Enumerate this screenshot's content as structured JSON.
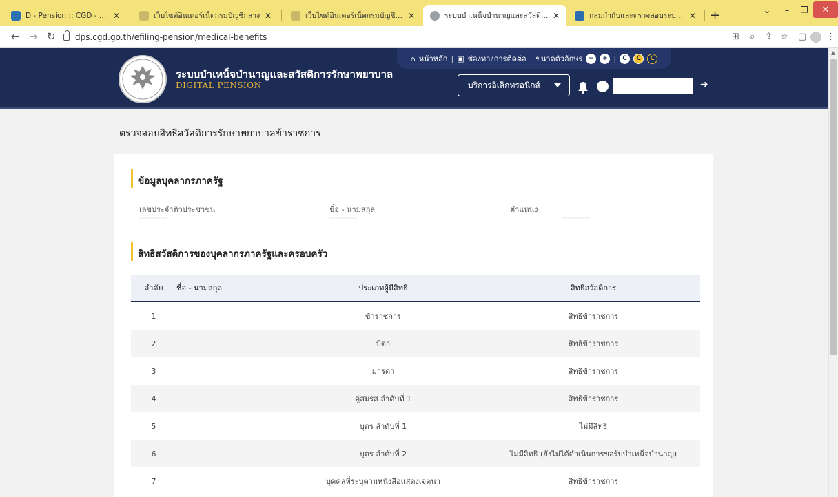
{
  "browser": {
    "tabs": [
      {
        "title": "D - Pension :: CGD - D - Pension",
        "color": "#2f6fb3",
        "active": false
      },
      {
        "title": "เว็บไซต์อินเตอร์เน็ตกรมบัญชีกลาง",
        "color": "#c9b86a",
        "active": false
      },
      {
        "title": "เว็บไซต์อินเตอร์เน็ตกรมบัญชีกลาง",
        "color": "#c9b86a",
        "active": false
      },
      {
        "title": "ระบบบำเหน็จบำนาญและสวัสดิการรักษ",
        "color": "#9aa0a6",
        "active": true
      },
      {
        "title": "กลุ่มกำกับและตรวจสอบระบบสวัสดิการ",
        "color": "#2b6cb0",
        "active": false
      }
    ],
    "new_tab": "+",
    "url": "dps.cgd.go.th/efiling-pension/medical-benefits",
    "window_controls": {
      "dropdown": "⌄",
      "minimize": "–",
      "maximize": "❐",
      "close": "✕"
    }
  },
  "header": {
    "title": "ระบบบำเหน็จบำนาญและสวัสดิการรักษาพยาบาล",
    "subtitle": "DIGITAL PENSION",
    "top_links": {
      "home": "หน้าหลัก",
      "contact": "ช่องทางการติดต่อ",
      "font_size": "ขนาดตัวอักษร",
      "font_minus": "−",
      "font_plus": "+",
      "contrast_c": "C"
    },
    "eservice_label": "บริการอิเล็กทรอนิกส์"
  },
  "page_title": "ตรวจสอบสิทธิสวัสดิการรักษาพยาบาลข้าราชการ",
  "personnel_section": {
    "title": "ข้อมูลบุคลากรภาครัฐ",
    "labels": {
      "id_card": "เลขประจำตัวประชาชน",
      "name": "ชื่อ - นามสกุล",
      "position": "ตำแหน่ง"
    }
  },
  "benefit_section": {
    "title": "สิทธิสวัสดิการของบุคลากรภาครัฐและครอบครัว",
    "columns": [
      "ลำดับ",
      "ชื่อ - นามสกุล",
      "ประเภทผู้มีสิทธิ",
      "สิทธิสวัสดิการ"
    ],
    "rows": [
      {
        "no": "1",
        "name": "",
        "type": "ข้าราชการ",
        "right": "สิทธิข้าราชการ"
      },
      {
        "no": "2",
        "name": "",
        "type": "บิดา",
        "right": "สิทธิข้าราชการ"
      },
      {
        "no": "3",
        "name": "",
        "type": "มารดา",
        "right": "สิทธิข้าราชการ"
      },
      {
        "no": "4",
        "name": "",
        "type": "คู่สมรส ลำดับที่ 1",
        "right": "สิทธิข้าราชการ"
      },
      {
        "no": "5",
        "name": "",
        "type": "บุตร ลำดับที่ 1",
        "right": "ไม่มีสิทธิ"
      },
      {
        "no": "6",
        "name": "",
        "type": "บุตร ลำดับที่ 2",
        "right": "ไม่มีสิทธิ (ยังไม่ได้ดำเนินการขอรับบำเหน็จบำนาญ)"
      },
      {
        "no": "7",
        "name": "",
        "type": "บุคคลที่ระบุตามหนังสือแสดงเจตนา",
        "right": "สิทธิข้าราชการ"
      }
    ]
  },
  "colors": {
    "header_bg": "#1c2c55",
    "accent_yellow": "#f2c230",
    "tabbar_bg": "#f4e27a",
    "subtitle_gold": "#e3b23c"
  }
}
